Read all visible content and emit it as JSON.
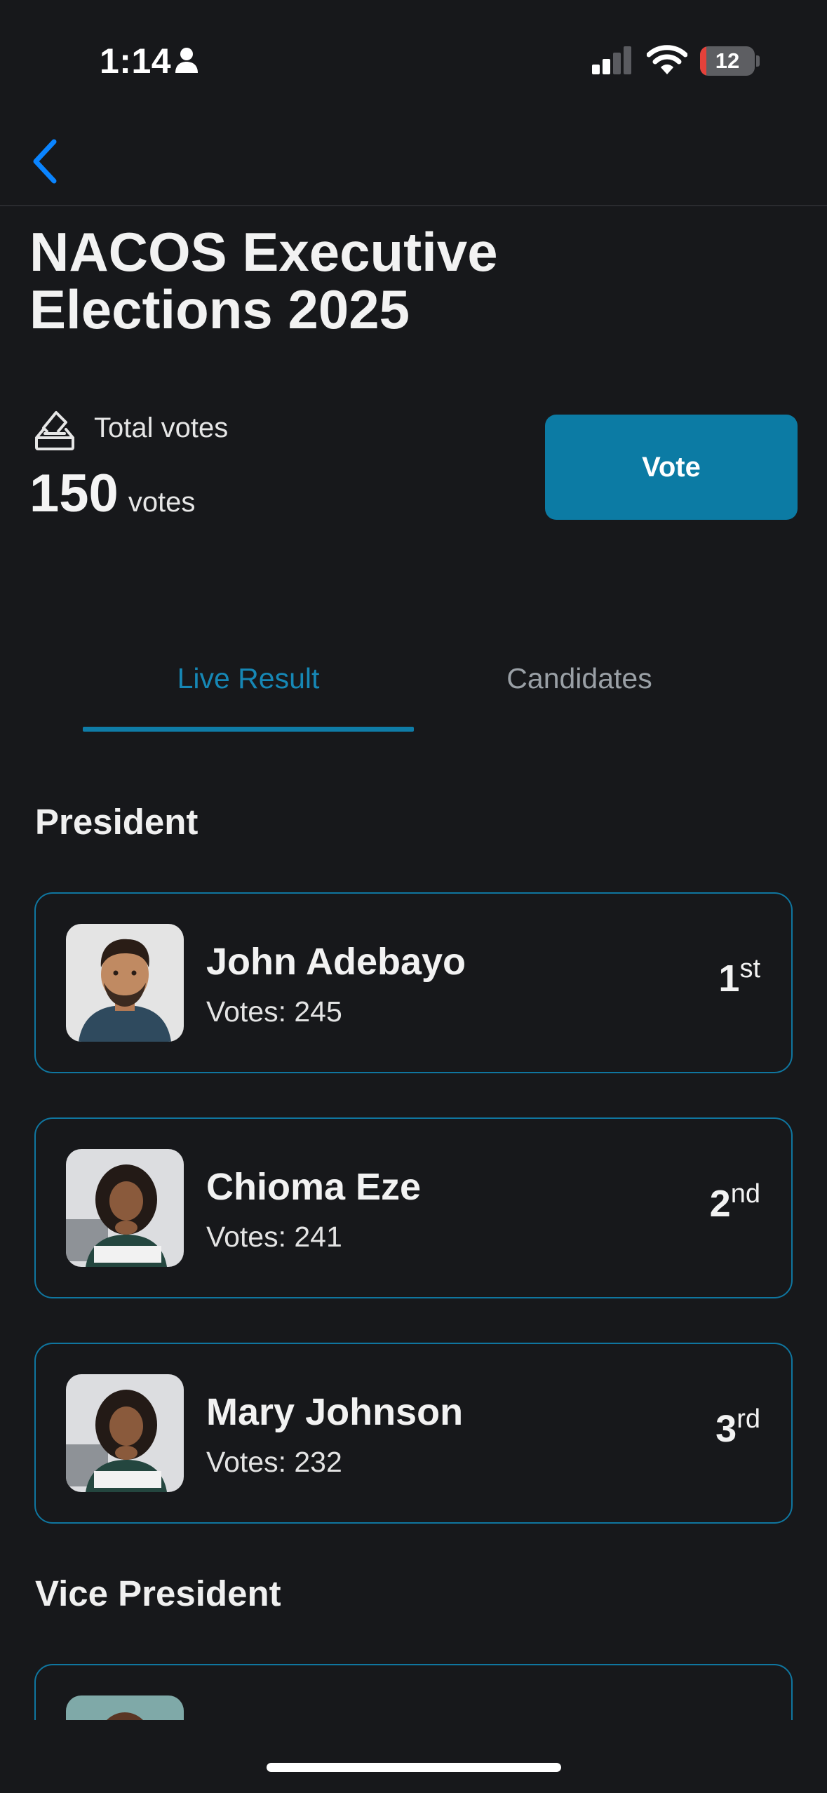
{
  "status_bar": {
    "time": "1:14",
    "battery_level": "12",
    "battery_fraction": 0.12,
    "icons": [
      "person-icon",
      "cellular-signal-icon",
      "wifi-icon",
      "battery-icon"
    ]
  },
  "nav": {
    "back_icon": "chevron-left-icon"
  },
  "election": {
    "title": "NACOS Executive Elections 2025",
    "total_votes_label": "Total votes",
    "total_votes_value": "150",
    "total_votes_unit": "votes",
    "vote_button_label": "Vote"
  },
  "tabs": [
    {
      "label": "Live Result",
      "active": true
    },
    {
      "label": "Candidates",
      "active": false
    }
  ],
  "sections": [
    {
      "title": "President",
      "candidates": [
        {
          "name": "John Adebayo",
          "votes": "Votes: 245",
          "rank": "1",
          "rank_suffix": "st"
        },
        {
          "name": "Chioma Eze",
          "votes": "Votes: 241",
          "rank": "2",
          "rank_suffix": "nd"
        },
        {
          "name": "Mary Johnson",
          "votes": "Votes: 232",
          "rank": "3",
          "rank_suffix": "rd"
        }
      ]
    },
    {
      "title": "Vice President",
      "candidates": []
    }
  ],
  "colors": {
    "background": "#17181b",
    "accent": "#0c7ba4",
    "active_tab": "#1687b5",
    "card_border": "#0f76a0",
    "inactive_tab": "#9aa0a6"
  }
}
